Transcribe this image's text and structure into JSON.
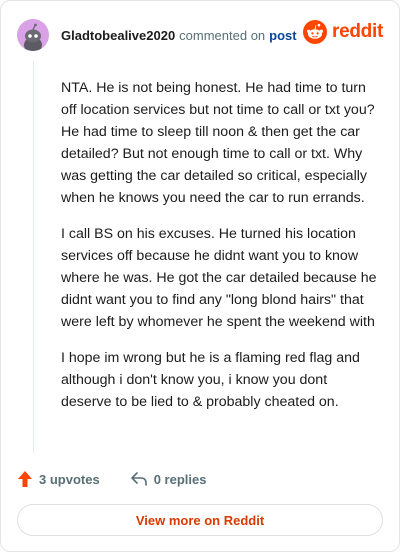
{
  "comment": {
    "username": "Gladtobealive2020",
    "action_text": "commented on",
    "post_link": "post",
    "paragraphs": [
      "NTA. He is not being honest. He had time to turn off location services but not time to call or txt you? He had time to sleep till noon & then get the car detailed? But not enough time to call or txt. Why was getting the car detailed so critical, especially when he knows you need the car to run errands.",
      "I call BS on his excuses. He turned his location services off because he didnt want you to know where he was. He got the car detailed because he didnt want you to find any \"long blond hairs\" that were left by whomever he spent the weekend with",
      "I hope im wrong but he is a flaming red flag and although i don't know you, i know you dont deserve to be lied to & probably cheated on."
    ]
  },
  "brand": {
    "wordmark": "reddit",
    "color": "#ff4500"
  },
  "footer": {
    "upvotes": "3 upvotes",
    "replies": "0 replies",
    "view_more": "View more on Reddit"
  },
  "colors": {
    "accent": "#ff4500",
    "link": "#0a449b",
    "muted": "#576f76",
    "avatar_bg": "#d9a2e6"
  },
  "icons": [
    "avatar-icon",
    "reddit-logo-icon",
    "upvote-arrow-icon",
    "reply-arrow-icon"
  ]
}
